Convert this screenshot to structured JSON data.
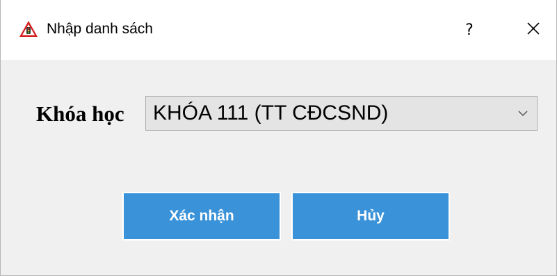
{
  "window": {
    "title": "Nhập danh sách",
    "icon": "warning-triangle-icon",
    "help_label": "?",
    "close_icon": "close-icon"
  },
  "form": {
    "course_label": "Khóa học",
    "course_value": "KHÓA 111 (TT CĐCSND)"
  },
  "buttons": {
    "confirm_label": "Xác nhận",
    "cancel_label": "Hủy"
  },
  "colors": {
    "button_bg": "#3a92d8",
    "dialog_bg": "#f0f0f0",
    "combo_bg": "#e4e4e4",
    "icon_red": "#d42020"
  }
}
